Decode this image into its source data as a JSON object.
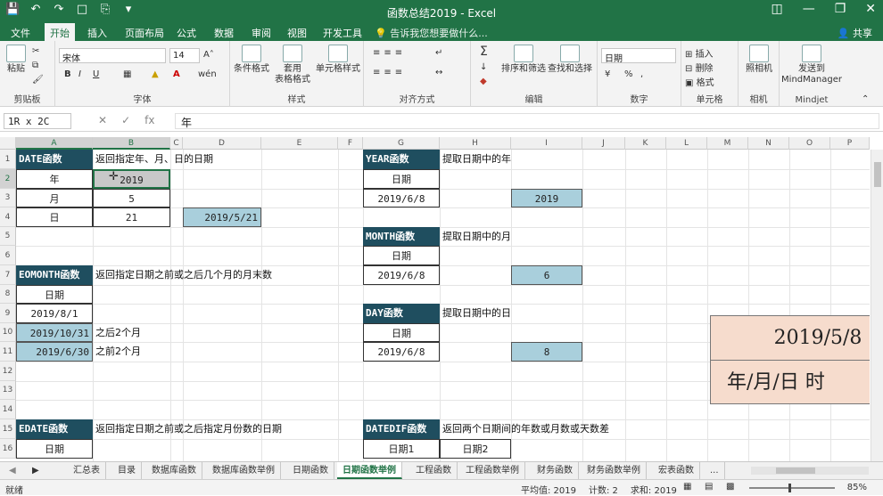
{
  "window": {
    "title": "函数总结2019 - Excel",
    "qat_icons": [
      "save-icon",
      "undo-icon",
      "redo-icon",
      "new-file-icon",
      "print-preview-icon",
      "customize-qat-icon"
    ],
    "controls": [
      "ribbon-display-icon",
      "minimize-icon",
      "restore-icon",
      "close-icon"
    ]
  },
  "tabs": [
    "文件",
    "开始",
    "插入",
    "页面布局",
    "公式",
    "数据",
    "审阅",
    "视图",
    "开发工具"
  ],
  "active_tab": "开始",
  "tell_me": "告诉我您想要做什么...",
  "share": "共享",
  "ribbon": {
    "clipboard": {
      "label": "剪贴板",
      "paste": "粘贴"
    },
    "font": {
      "label": "字体",
      "name": "宋体",
      "size": "14",
      "bold": "B",
      "italic": "I",
      "underline": "U",
      "wen": "wén"
    },
    "alignment": {
      "label": "对齐方式"
    },
    "styles": {
      "label": "样式",
      "cond": "条件格式",
      "table": "套用\n表格格式",
      "cell": "单元格样式"
    },
    "number": {
      "label": "数字",
      "format": "日期",
      "percent": "%",
      "comma": ","
    },
    "cells": {
      "label": "单元格",
      "insert": "插入",
      "delete": "删除",
      "format": "格式"
    },
    "editing": {
      "label": "编辑",
      "sort": "排序和筛选",
      "find": "查找和选择"
    },
    "camera": {
      "label": "相机",
      "btn": "照相机"
    },
    "mindjet": {
      "label": "Mindjet",
      "btn1": "发送到",
      "btn2": "MindManager"
    }
  },
  "formula_bar": {
    "name_box": "1R x 2C",
    "fx": "fx",
    "value": "年"
  },
  "columns": [
    "A",
    "B",
    "C",
    "D",
    "E",
    "F",
    "G",
    "H",
    "I",
    "J",
    "K",
    "L",
    "M",
    "N",
    "O",
    "P"
  ],
  "rows": [
    "1",
    "2",
    "3",
    "4",
    "5",
    "6",
    "7",
    "8",
    "9",
    "10",
    "11",
    "12",
    "13",
    "14",
    "15",
    "16"
  ],
  "cells": {
    "A1": "DATE函数",
    "B1": "返回指定年、月、日的日期",
    "A2": "年",
    "B2": "2019",
    "A3": "月",
    "B3": "5",
    "A4": "日",
    "B4": "21",
    "D4": "2019/5/21",
    "G1": "YEAR函数",
    "H1": "提取日期中的年",
    "G2": "日期",
    "G3": "2019/6/8",
    "I3": "2019",
    "G5": "MONTH函数",
    "H5": "提取日期中的月",
    "G6": "日期",
    "G7": "2019/6/8",
    "I7": "6",
    "A7": "EOMONTH函数",
    "B7": "返回指定日期之前或之后几个月的月末数",
    "A8": "日期",
    "A9": "2019/8/1",
    "A10": "2019/10/31",
    "B10": "之后2个月",
    "A11": "2019/6/30",
    "B11": "之前2个月",
    "G9": "DAY函数",
    "H9": "提取日期中的日",
    "G10": "日期",
    "G11": "2019/6/8",
    "I11": "8",
    "A15": "EDATE函数",
    "B15": "返回指定日期之前或之后指定月份数的日期",
    "A16": "日期",
    "G15": "DATEDIF函数",
    "H15": "返回两个日期间的年数或月数或天数差",
    "G16": "日期1",
    "H16": "日期2"
  },
  "big_box": {
    "line1": "2019/5/8",
    "line2": "年/月/日 时"
  },
  "sheet_tabs": [
    "汇总表",
    "目录",
    "数据库函数",
    "数据库函数举例",
    "日期函数",
    "日期函数举例",
    "工程函数",
    "工程函数举例",
    "财务函数",
    "财务函数举例",
    "宏表函数",
    "..."
  ],
  "active_sheet": "日期函数举例",
  "status": {
    "ready": "就绪",
    "average": "平均值: 2019",
    "count": "计数: 2",
    "sum": "求和: 2019",
    "zoom": "85%"
  },
  "colors": {
    "excel_green": "#217346",
    "header_fill": "#1f4e5f",
    "blue_fill": "#a9cfdc",
    "peach_fill": "#f6dccd"
  }
}
